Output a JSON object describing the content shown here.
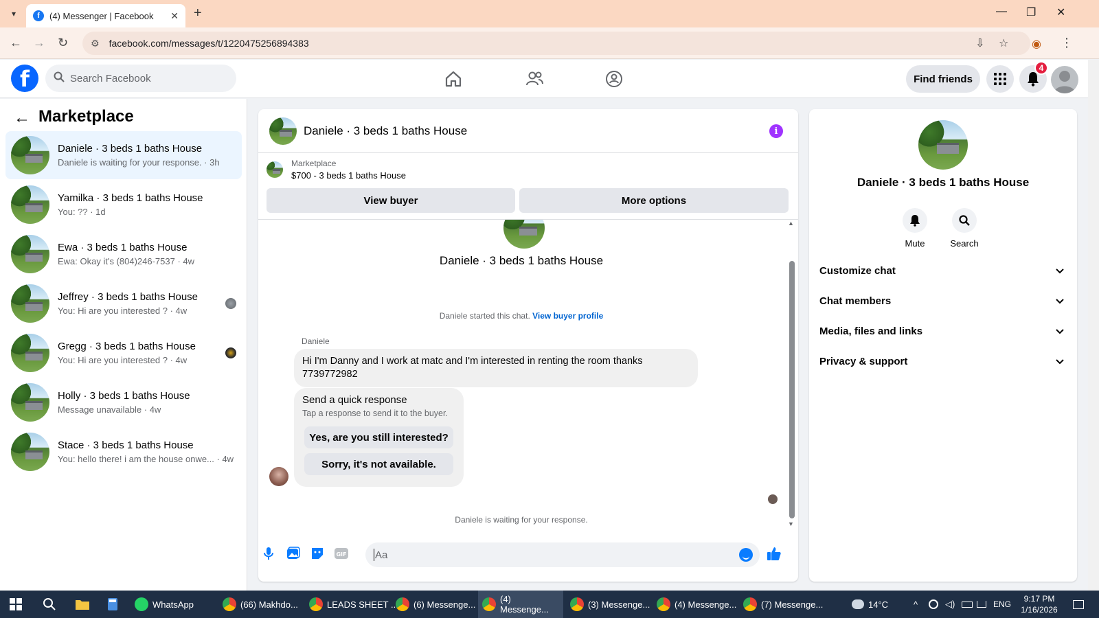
{
  "browser": {
    "tab_title": "(4) Messenger | Facebook",
    "url": "facebook.com/messages/t/1220475256894383"
  },
  "fb": {
    "search_placeholder": "Search Facebook",
    "find_friends": "Find friends",
    "notification_count": "4"
  },
  "sidebar": {
    "title": "Marketplace",
    "conversations": [
      {
        "name": "Daniele · 3 beds 1 baths House",
        "preview": "Daniele is waiting for your response. · 3h",
        "active": true
      },
      {
        "name": "Yamilka · 3 beds 1 baths House",
        "preview": "You: ?? · 1d"
      },
      {
        "name": "Ewa · 3 beds 1 baths House",
        "preview": "Ewa: Okay it's (804)246-7537 · 4w"
      },
      {
        "name": "Jeffrey · 3 beds 1 baths House",
        "preview": "You: Hi are you interested ? · 4w"
      },
      {
        "name": "Gregg · 3 beds 1 baths House",
        "preview": "You: Hi are you interested ? · 4w"
      },
      {
        "name": "Holly · 3 beds 1 baths House",
        "preview": "Message unavailable · 4w"
      },
      {
        "name": "Stace · 3 beds 1 baths House",
        "preview": "You: hello there! i am the house onwe... · 4w"
      }
    ]
  },
  "chat": {
    "title": "Daniele · 3 beds 1 baths House",
    "listing_category": "Marketplace",
    "listing_price": "$700 - 3 beds 1 baths House",
    "view_buyer": "View buyer",
    "more_options": "More options",
    "header_name": "Daniele · 3 beds 1 baths House",
    "started_text": "Daniele started this chat.",
    "view_buyer_profile": "View buyer profile",
    "sender": "Daniele",
    "message": "Hi I'm Danny and I work at matc and I'm interested in renting the room thanks 7739772982",
    "quick_title": "Send a quick response",
    "quick_sub": "Tap a response to send it to the buyer.",
    "quick_1": "Yes, are you still interested?",
    "quick_2": "Sorry, it's not available.",
    "waiting": "Daniele is waiting for your response.",
    "input_placeholder": "Aa"
  },
  "details": {
    "name": "Daniele · 3 beds 1 baths House",
    "mute": "Mute",
    "search": "Search",
    "sections": [
      "Customize chat",
      "Chat members",
      "Media, files and links",
      "Privacy & support"
    ]
  },
  "taskbar": {
    "apps": [
      {
        "label": "WhatsApp",
        "color": "#25d366"
      },
      {
        "label": "(66) Makhdo...",
        "color": "#ea4335"
      },
      {
        "label": "LEADS SHEET ...",
        "color": "#ea4335"
      },
      {
        "label": "(6) Messenge...",
        "color": "#ea4335"
      },
      {
        "label": "(4) Messenge...",
        "color": "#ea4335",
        "active": true
      },
      {
        "label": "(3) Messenge...",
        "color": "#ea4335"
      },
      {
        "label": "(4) Messenge...",
        "color": "#ea4335"
      },
      {
        "label": "(7) Messenge...",
        "color": "#ea4335"
      }
    ],
    "weather": "14°C",
    "lang": "ENG",
    "time": "9:17 PM",
    "date": "1/16/2026"
  },
  "colors": {
    "fb_blue": "#0866ff",
    "active_conv": "#ebf5ff",
    "info_purple": "#a033ff",
    "taskbar": "#1f2f45"
  }
}
